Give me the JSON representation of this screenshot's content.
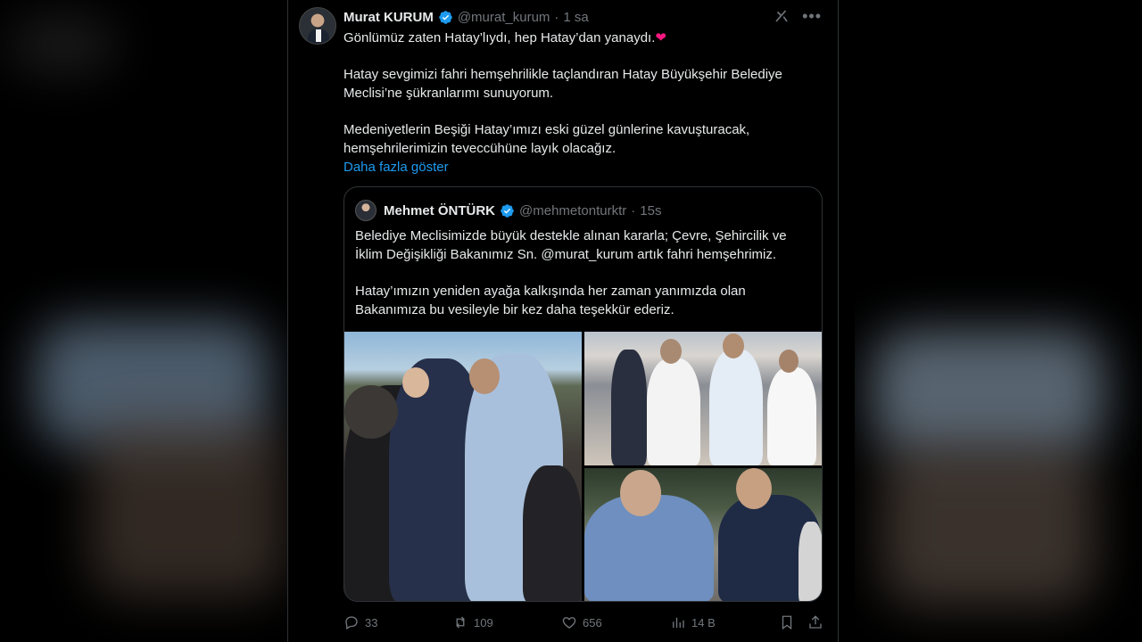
{
  "author": {
    "name": "Murat KURUM",
    "handle": "@murat_kurum",
    "separator": "·",
    "time": "1 sa"
  },
  "tweet": {
    "paragraphs": [
      "Gönlümüz zaten Hatay’lıydı, hep Hatay’dan yanaydı.",
      "Hatay sevgimizi fahri hemşehrilikle taçlandıran Hatay Büyükşehir Belediye Meclisi’ne şükranlarımı sunuyorum.",
      "Medeniyetlerin Beşiği Hatay’ımızı eski güzel günlerine kavuşturacak, hemşehrilerimizin teveccühüne layık olacağız."
    ],
    "heart_emoji": "❤",
    "show_more": "Daha fazla göster"
  },
  "quote": {
    "name": "Mehmet ÖNTÜRK",
    "handle": "@mehmetonturktr",
    "separator": "·",
    "time": "15s",
    "paragraphs": [
      "Belediye Meclisimizde büyük destekle alınan kararla; Çevre, Şehircilik ve İklim Değişikliği Bakanımız Sn. @murat_kurum artık fahri hemşehrimiz.",
      "Hatay’ımızın yeniden ayağa kalkışında her zaman yanımızda olan Bakanımıza bu vesileyle bir kez daha teşekkür ederiz."
    ],
    "photos": [
      "photo-1",
      "photo-2",
      "photo-3"
    ]
  },
  "actions": {
    "replies": "33",
    "reposts": "109",
    "likes": "656",
    "views": "14 B"
  },
  "icons": {
    "verified": "verified-badge-icon",
    "grok": "grok-icon",
    "more": "more-icon",
    "reply": "reply-icon",
    "repost": "repost-icon",
    "like": "heart-icon",
    "views": "views-icon",
    "bookmark": "bookmark-icon",
    "share": "share-icon"
  },
  "colors": {
    "accent": "#1d9bf0",
    "text": "#e7e9ea",
    "muted": "#71767b",
    "background": "#000000",
    "heart": "#f91880"
  }
}
